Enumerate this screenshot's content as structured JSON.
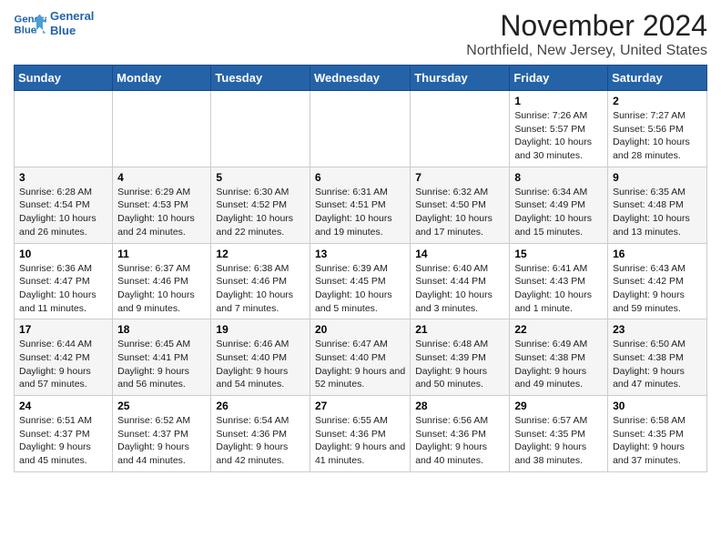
{
  "header": {
    "logo_line1": "General",
    "logo_line2": "Blue",
    "month": "November 2024",
    "location": "Northfield, New Jersey, United States"
  },
  "days_of_week": [
    "Sunday",
    "Monday",
    "Tuesday",
    "Wednesday",
    "Thursday",
    "Friday",
    "Saturday"
  ],
  "weeks": [
    [
      {
        "day": "",
        "info": ""
      },
      {
        "day": "",
        "info": ""
      },
      {
        "day": "",
        "info": ""
      },
      {
        "day": "",
        "info": ""
      },
      {
        "day": "",
        "info": ""
      },
      {
        "day": "1",
        "info": "Sunrise: 7:26 AM\nSunset: 5:57 PM\nDaylight: 10 hours and 30 minutes."
      },
      {
        "day": "2",
        "info": "Sunrise: 7:27 AM\nSunset: 5:56 PM\nDaylight: 10 hours and 28 minutes."
      }
    ],
    [
      {
        "day": "3",
        "info": "Sunrise: 6:28 AM\nSunset: 4:54 PM\nDaylight: 10 hours and 26 minutes."
      },
      {
        "day": "4",
        "info": "Sunrise: 6:29 AM\nSunset: 4:53 PM\nDaylight: 10 hours and 24 minutes."
      },
      {
        "day": "5",
        "info": "Sunrise: 6:30 AM\nSunset: 4:52 PM\nDaylight: 10 hours and 22 minutes."
      },
      {
        "day": "6",
        "info": "Sunrise: 6:31 AM\nSunset: 4:51 PM\nDaylight: 10 hours and 19 minutes."
      },
      {
        "day": "7",
        "info": "Sunrise: 6:32 AM\nSunset: 4:50 PM\nDaylight: 10 hours and 17 minutes."
      },
      {
        "day": "8",
        "info": "Sunrise: 6:34 AM\nSunset: 4:49 PM\nDaylight: 10 hours and 15 minutes."
      },
      {
        "day": "9",
        "info": "Sunrise: 6:35 AM\nSunset: 4:48 PM\nDaylight: 10 hours and 13 minutes."
      }
    ],
    [
      {
        "day": "10",
        "info": "Sunrise: 6:36 AM\nSunset: 4:47 PM\nDaylight: 10 hours and 11 minutes."
      },
      {
        "day": "11",
        "info": "Sunrise: 6:37 AM\nSunset: 4:46 PM\nDaylight: 10 hours and 9 minutes."
      },
      {
        "day": "12",
        "info": "Sunrise: 6:38 AM\nSunset: 4:46 PM\nDaylight: 10 hours and 7 minutes."
      },
      {
        "day": "13",
        "info": "Sunrise: 6:39 AM\nSunset: 4:45 PM\nDaylight: 10 hours and 5 minutes."
      },
      {
        "day": "14",
        "info": "Sunrise: 6:40 AM\nSunset: 4:44 PM\nDaylight: 10 hours and 3 minutes."
      },
      {
        "day": "15",
        "info": "Sunrise: 6:41 AM\nSunset: 4:43 PM\nDaylight: 10 hours and 1 minute."
      },
      {
        "day": "16",
        "info": "Sunrise: 6:43 AM\nSunset: 4:42 PM\nDaylight: 9 hours and 59 minutes."
      }
    ],
    [
      {
        "day": "17",
        "info": "Sunrise: 6:44 AM\nSunset: 4:42 PM\nDaylight: 9 hours and 57 minutes."
      },
      {
        "day": "18",
        "info": "Sunrise: 6:45 AM\nSunset: 4:41 PM\nDaylight: 9 hours and 56 minutes."
      },
      {
        "day": "19",
        "info": "Sunrise: 6:46 AM\nSunset: 4:40 PM\nDaylight: 9 hours and 54 minutes."
      },
      {
        "day": "20",
        "info": "Sunrise: 6:47 AM\nSunset: 4:40 PM\nDaylight: 9 hours and 52 minutes."
      },
      {
        "day": "21",
        "info": "Sunrise: 6:48 AM\nSunset: 4:39 PM\nDaylight: 9 hours and 50 minutes."
      },
      {
        "day": "22",
        "info": "Sunrise: 6:49 AM\nSunset: 4:38 PM\nDaylight: 9 hours and 49 minutes."
      },
      {
        "day": "23",
        "info": "Sunrise: 6:50 AM\nSunset: 4:38 PM\nDaylight: 9 hours and 47 minutes."
      }
    ],
    [
      {
        "day": "24",
        "info": "Sunrise: 6:51 AM\nSunset: 4:37 PM\nDaylight: 9 hours and 45 minutes."
      },
      {
        "day": "25",
        "info": "Sunrise: 6:52 AM\nSunset: 4:37 PM\nDaylight: 9 hours and 44 minutes."
      },
      {
        "day": "26",
        "info": "Sunrise: 6:54 AM\nSunset: 4:36 PM\nDaylight: 9 hours and 42 minutes."
      },
      {
        "day": "27",
        "info": "Sunrise: 6:55 AM\nSunset: 4:36 PM\nDaylight: 9 hours and 41 minutes."
      },
      {
        "day": "28",
        "info": "Sunrise: 6:56 AM\nSunset: 4:36 PM\nDaylight: 9 hours and 40 minutes."
      },
      {
        "day": "29",
        "info": "Sunrise: 6:57 AM\nSunset: 4:35 PM\nDaylight: 9 hours and 38 minutes."
      },
      {
        "day": "30",
        "info": "Sunrise: 6:58 AM\nSunset: 4:35 PM\nDaylight: 9 hours and 37 minutes."
      }
    ]
  ]
}
